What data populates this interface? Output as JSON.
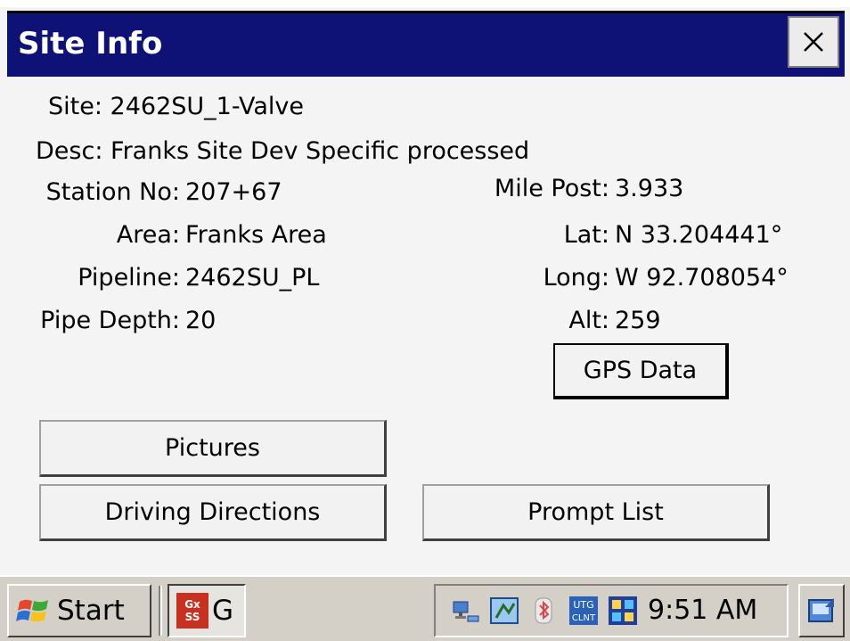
{
  "window": {
    "title": "Site Info",
    "close_icon": "close-icon"
  },
  "site": {
    "site_label": "Site:",
    "site_value": "2462SU_1-Valve",
    "desc_label": "Desc:",
    "desc_value": "Franks Site Dev Specific processed",
    "station_label": "Station No:",
    "station_value": "207+67",
    "area_label": "Area:",
    "area_value": "Franks Area",
    "pipeline_label": "Pipeline:",
    "pipeline_value": "2462SU_PL",
    "depth_label": "Pipe Depth:",
    "depth_value": "20",
    "milepost_label": "Mile Post:",
    "milepost_value": "3.933",
    "lat_label": "Lat:",
    "lat_value": "N 33.204441°",
    "long_label": "Long:",
    "long_value": "W 92.708054°",
    "alt_label": "Alt:",
    "alt_value": "259"
  },
  "buttons": {
    "gps": "GPS Data",
    "pictures": "Pictures",
    "driving": "Driving Directions",
    "prompt": "Prompt List"
  },
  "taskbar": {
    "start_label": "Start",
    "app_icon_text_top": "Gx",
    "app_icon_text_bottom": "SS",
    "app_label": "G",
    "clock": "9:51 AM",
    "tray_icon_text_top": "UTG",
    "tray_icon_text_bottom": "CLNT"
  },
  "colors": {
    "titlebar": "#0e1277",
    "background": "#f4f4f4",
    "taskbar": "#d4d0c8"
  }
}
